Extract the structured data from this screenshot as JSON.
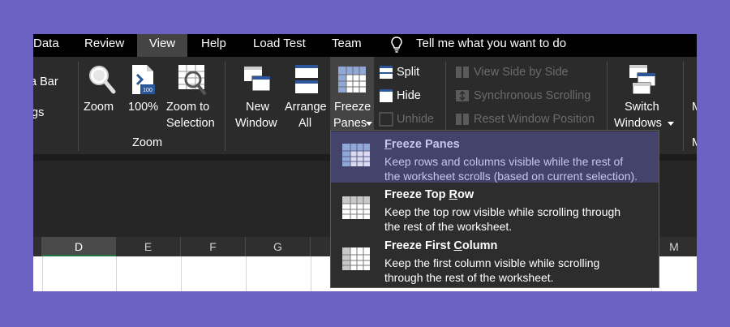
{
  "menu": {
    "tabs": [
      "Data",
      "Review",
      "View",
      "Help",
      "Load Test",
      "Team"
    ],
    "active_tab": "View",
    "tell_me": "Tell me what you want to do"
  },
  "ribbon": {
    "left_partial": {
      "line1": "a Bar",
      "line2": "gs"
    },
    "zoom_group": {
      "zoom": "Zoom",
      "hundred": "100%",
      "zoom_sel_line1": "Zoom to",
      "zoom_sel_line2": "Selection",
      "group_label": "Zoom"
    },
    "window_group": {
      "new_window_line1": "New",
      "new_window_line2": "Window",
      "arrange_line1": "Arrange",
      "arrange_line2": "All",
      "freeze_line1": "Freeze",
      "freeze_line2": "Panes",
      "split": "Split",
      "hide": "Hide",
      "unhide": "Unhide",
      "side_by_side": "View Side by Side",
      "sync_scroll": "Synchronous Scrolling",
      "reset_pos": "Reset Window Position",
      "switch_line1": "Switch",
      "switch_line2": "Windows",
      "right_partial_1": "M",
      "right_partial_2": "M"
    }
  },
  "freeze_menu": {
    "items": [
      {
        "title_underline": "F",
        "title_rest": "reeze Panes",
        "desc_line1": "Keep rows and columns visible while the rest of",
        "desc_line2": "the worksheet scrolls (based on current selection)."
      },
      {
        "title_pre": "Freeze Top ",
        "title_underline": "R",
        "title_rest": "ow",
        "desc_line1": "Keep the top row visible while scrolling through",
        "desc_line2": "the rest of the worksheet."
      },
      {
        "title_pre": "Freeze First ",
        "title_underline": "C",
        "title_rest": "olumn",
        "desc_line1": "Keep the first column visible while scrolling",
        "desc_line2": "through the rest of the worksheet."
      }
    ]
  },
  "sheet": {
    "columns": [
      "D",
      "E",
      "F",
      "G",
      "M"
    ],
    "selected_column": "D"
  },
  "colors": {
    "background": "#6b62c4",
    "menu_hover": "#43436b",
    "selected_column_underline": "#217346"
  }
}
